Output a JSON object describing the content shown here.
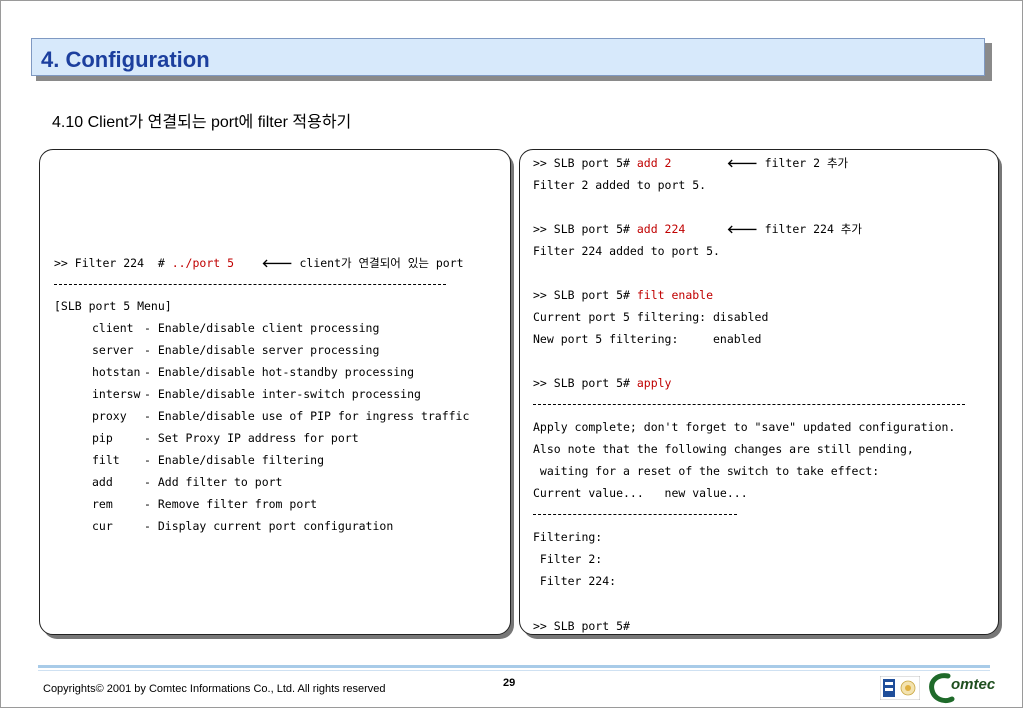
{
  "slide": {
    "title": "4. Configuration",
    "subtitle": "4.10 Client가 연결되는 port에 filter 적용하기",
    "page_number": "29",
    "copyright": "Copyrights© 2001 by Comtec Informations Co., Ltd. All rights reserved"
  },
  "left_panel": {
    "cmd_prompt": ">> Filter 224  # ",
    "cmd_input": "../port 5",
    "cmd_note": " client가 연결되어 있는 port",
    "menu_title": "[SLB port 5 Menu]",
    "menu_items": [
      {
        "cmd": "client",
        "desc": "- Enable/disable client processing"
      },
      {
        "cmd": "server",
        "desc": "- Enable/disable server processing"
      },
      {
        "cmd": "hotstan",
        "desc": "- Enable/disable hot-standby processing"
      },
      {
        "cmd": "intersw",
        "desc": "- Enable/disable inter-switch processing"
      },
      {
        "cmd": "proxy",
        "desc": "- Enable/disable use of PIP for ingress traffic"
      },
      {
        "cmd": "pip",
        "desc": "- Set Proxy IP address for port"
      },
      {
        "cmd": "filt",
        "desc": "- Enable/disable filtering"
      },
      {
        "cmd": "add",
        "desc": "- Add filter to port"
      },
      {
        "cmd": "rem",
        "desc": "- Remove filter from port"
      },
      {
        "cmd": "cur",
        "desc": "- Display current port configuration"
      }
    ]
  },
  "right_panel": {
    "prompt": ">> SLB port 5# ",
    "cmd1": "add 2",
    "note1": " filter 2 추가",
    "out1": "Filter 2 added to port 5.",
    "cmd2": "add 224",
    "note2": " filter 224 추가",
    "out2": "Filter 224 added to port 5.",
    "cmd3": "filt enable",
    "out3a": "Current port 5 filtering: disabled",
    "out3b": "New port 5 filtering:     enabled",
    "cmd4": "apply",
    "apply1": "Apply complete; don't forget to \"save\" updated configuration.",
    "apply2": "Also note that the following changes are still pending,",
    "apply3": " waiting for a reset of the switch to take effect:",
    "apply4": "Current value...   new value...",
    "pend1": "Filtering:",
    "pend2": " Filter 2:",
    "pend3": " Filter 224:",
    "final_prompt": ">> SLB port 5#"
  },
  "icons": {
    "arrow": "left-arrow-icon"
  },
  "colors": {
    "title_text": "#1c3f9e",
    "title_bg": "#d7e9fb",
    "command_red": "#c00000"
  }
}
